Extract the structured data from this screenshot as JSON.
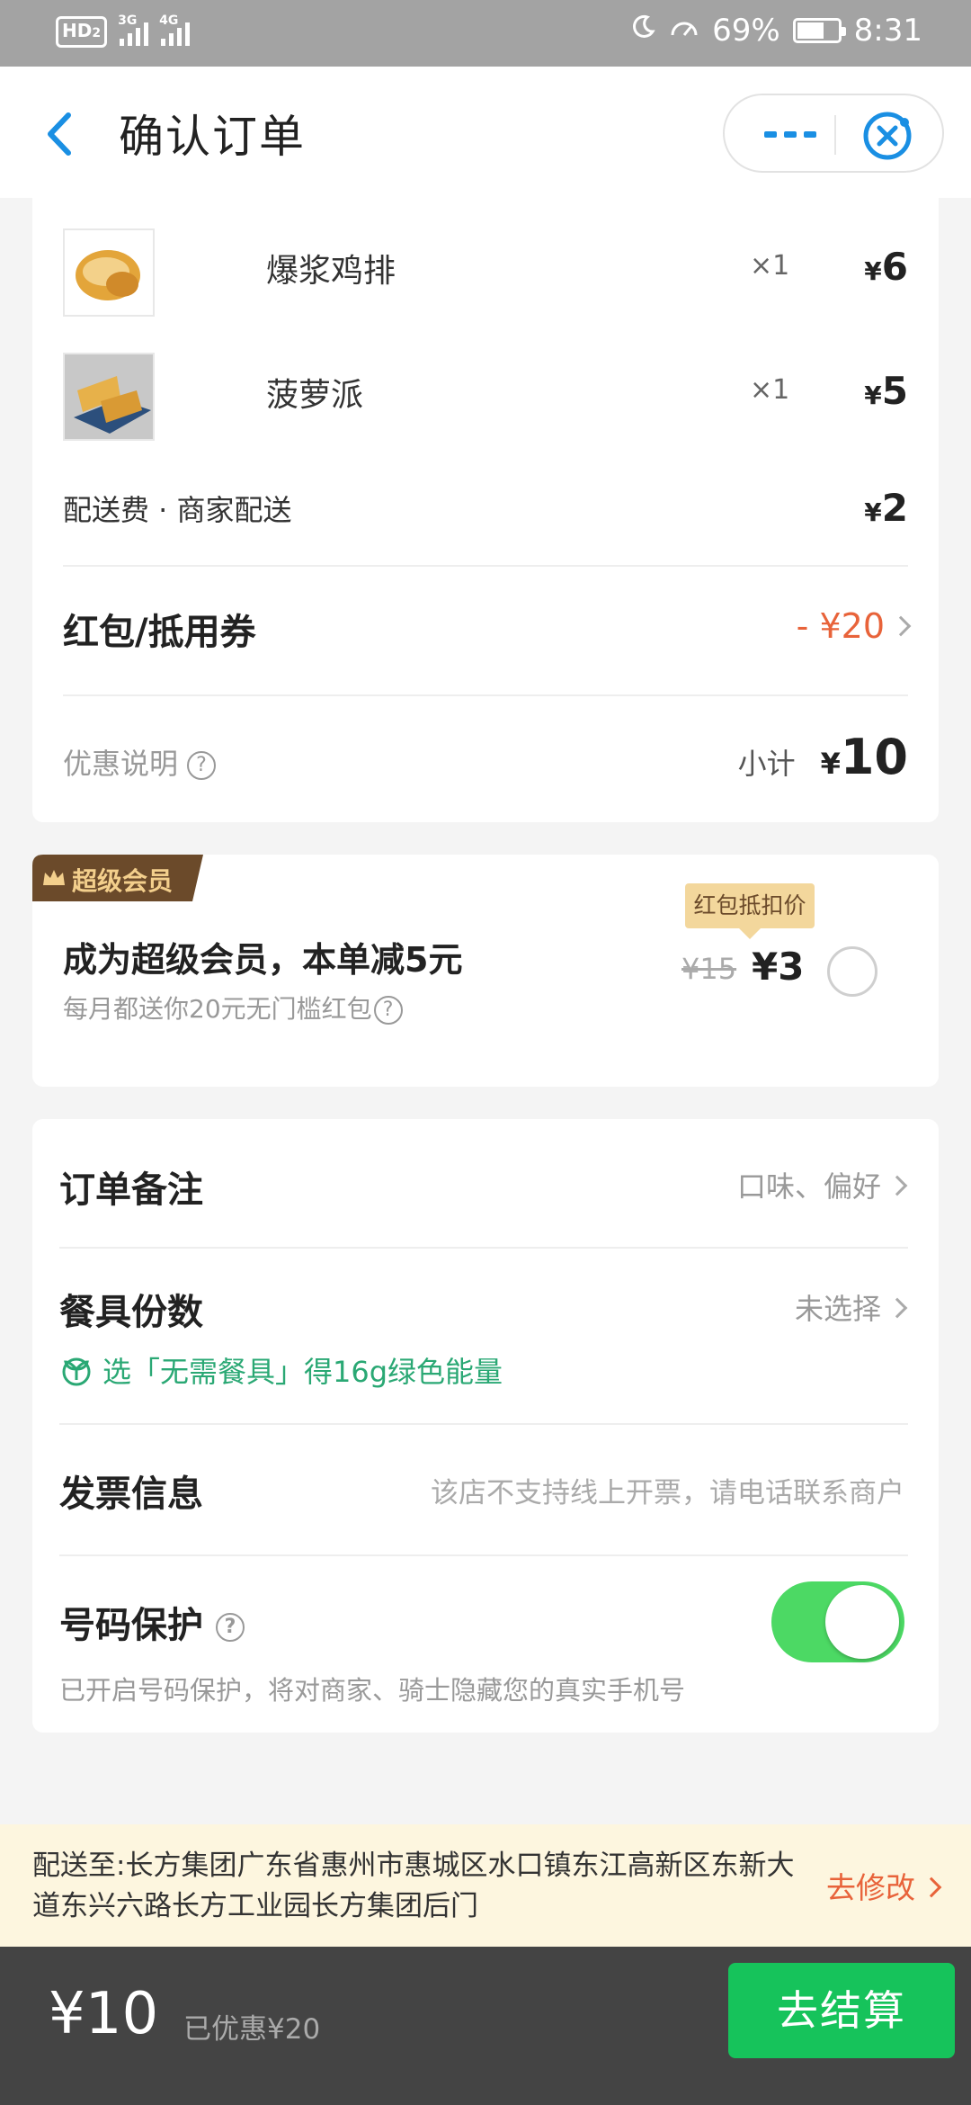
{
  "status_bar": {
    "hd_label": "HD",
    "sim_index": "2",
    "net1": "3G",
    "net2": "4G",
    "battery_text": "69%",
    "battery_level": 0.69,
    "time": "8:31"
  },
  "header": {
    "title": "确认订单",
    "more_icon": "more-dots-icon",
    "close_icon": "close-target-icon"
  },
  "order": {
    "items": [
      {
        "name": "爆浆鸡排",
        "qty": "×1",
        "currency": "¥",
        "price": "6"
      },
      {
        "name": "菠萝派",
        "qty": "×1",
        "currency": "¥",
        "price": "5"
      }
    ],
    "delivery": {
      "label": "配送费 · 商家配送",
      "currency": "¥",
      "price": "2"
    },
    "coupon": {
      "label": "红包/抵用券",
      "value": "- ¥20"
    },
    "discount_note": {
      "label": "优惠说明",
      "subtotal_label": "小计",
      "currency": "¥",
      "subtotal": "10"
    }
  },
  "member": {
    "badge": "超级会员",
    "headline": "成为超级会员，本单减5元",
    "subtext": "每月都送你20元无门槛红包",
    "tooltip": "红包抵扣价",
    "old_price": "¥15",
    "new_price": "¥3",
    "selected": false
  },
  "options": {
    "note": {
      "label": "订单备注",
      "value": "口味、偏好"
    },
    "tableware": {
      "label": "餐具份数",
      "value": "未选择",
      "eco_tip": "选「无需餐具」得16g绿色能量"
    },
    "invoice": {
      "label": "发票信息",
      "value": "该店不支持线上开票，请电话联系商户"
    },
    "privacy": {
      "label": "号码保护",
      "desc": "已开启号码保护，将对商家、骑士隐藏您的真实手机号",
      "enabled": true
    }
  },
  "address": {
    "text": "配送至:长方集团广东省惠州市惠城区水口镇东江高新区东新大道东兴六路长方工业园长方集团后门",
    "edit_label": "去修改"
  },
  "footer": {
    "total": "¥10",
    "saved": "已优惠¥20",
    "checkout_label": "去结算"
  },
  "colors": {
    "accent_blue": "#1a8fe3",
    "price_red": "#e8633a",
    "checkout_green": "#16c35b",
    "toggle_green": "#4cd964",
    "eco_green": "#2aa874"
  }
}
